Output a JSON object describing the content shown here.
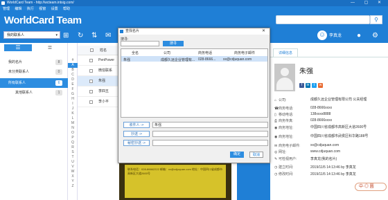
{
  "window": {
    "title": "WorldCard Team - http://wcteam.intsig.com/",
    "corner_text": "WorldCard"
  },
  "menu": [
    "管理",
    "编辑",
    "执行",
    "视窗",
    "设置",
    "帮助"
  ],
  "brand": "WorldCard Team",
  "search": {
    "placeholder": ""
  },
  "toolbar": {
    "group_select": "我的联系人",
    "user_name": "李真龙"
  },
  "sidebar": {
    "items": [
      {
        "label": "我的名片",
        "count": "8"
      },
      {
        "label": "未分类联系人",
        "count": "0"
      },
      {
        "label": "所有联系人",
        "count": "6"
      },
      {
        "label": "其他联系人",
        "count": "1"
      }
    ]
  },
  "alphabet": [
    "#",
    "A",
    "B",
    "C",
    "D",
    "E",
    "F",
    "G",
    "H",
    "I",
    "J",
    "K",
    "L",
    "M",
    "N",
    "O",
    "P",
    "Q",
    "R",
    "S",
    "T",
    "U",
    "V",
    "W",
    "X",
    "Y",
    "Z"
  ],
  "list": {
    "header": "姓名",
    "rows": [
      "PenPower",
      "微信联系",
      "朱强",
      "李四五",
      "李小平"
    ]
  },
  "card_image": {
    "text": "联系电话：028-86662222 邮箱：xx@cdjuquan.com 地址：中国四川省成都市高新区大道2600号"
  },
  "dialog": {
    "title": "查找名片",
    "search_label": "搜寻:",
    "search_button": "搜寻",
    "columns": [
      "全名",
      "公司",
      "商务电话",
      "商务电子邮件"
    ],
    "row": [
      "朱强",
      "成都久远企业管理有...",
      "028-8666...",
      "xx@cdjuquan.com"
    ],
    "to_button": "收件人 ->",
    "cc_button": "抄送 ->",
    "bcc_button": "秘密抄送 ->",
    "to_value": "朱强",
    "ok": "确定",
    "cancel": "取消"
  },
  "detail": {
    "tab": "详细信息",
    "name": "朱强",
    "fields": [
      {
        "icon": "building-icon",
        "glyph": "⌂",
        "label": "公司:",
        "value": "成都久远企业管理有限公司 公关经理"
      },
      {
        "icon": "phone-icon",
        "glyph": "☎",
        "label": "商务电话:",
        "value": "028-8666xxxx"
      },
      {
        "icon": "mobile-icon",
        "glyph": "▯",
        "label": "移动电话:",
        "value": "138xxxx8888"
      },
      {
        "icon": "fax-icon",
        "glyph": "⎙",
        "label": "商务传真:",
        "value": "028-8666xxxx"
      },
      {
        "icon": "location-icon",
        "glyph": "◉",
        "label": "商务地址:",
        "value": "中国四川省成都市高新区大道2600号"
      },
      {
        "icon": "location-icon",
        "glyph": "◉",
        "label": "商务地址:",
        "value": "中国四川省成都市武侯区科华路188号"
      },
      {
        "icon": "mail-icon",
        "glyph": "✉",
        "label": "商务电子邮件:",
        "value": "xx@cdjuquan.com"
      },
      {
        "icon": "web-icon",
        "glyph": "◎",
        "label": "网址:",
        "value": "www.cdjuquan.com"
      },
      {
        "icon": "note-icon",
        "glyph": "✎",
        "label": "可检视用户:",
        "value": "李真龙(我的名片)"
      },
      {
        "icon": "clock-icon",
        "glyph": "◷",
        "label": "建立时间:",
        "value": "2019/11/5 14:13:46 by 李真龙"
      },
      {
        "icon": "clock-icon",
        "glyph": "◷",
        "label": "修改时间:",
        "value": "2019/11/5 14:13:46 by 李真龙"
      }
    ]
  },
  "chat_pill": "中·◎ 圆",
  "colors": {
    "brand_blue": "#1f7fd6",
    "selected": "#2d8de0"
  }
}
